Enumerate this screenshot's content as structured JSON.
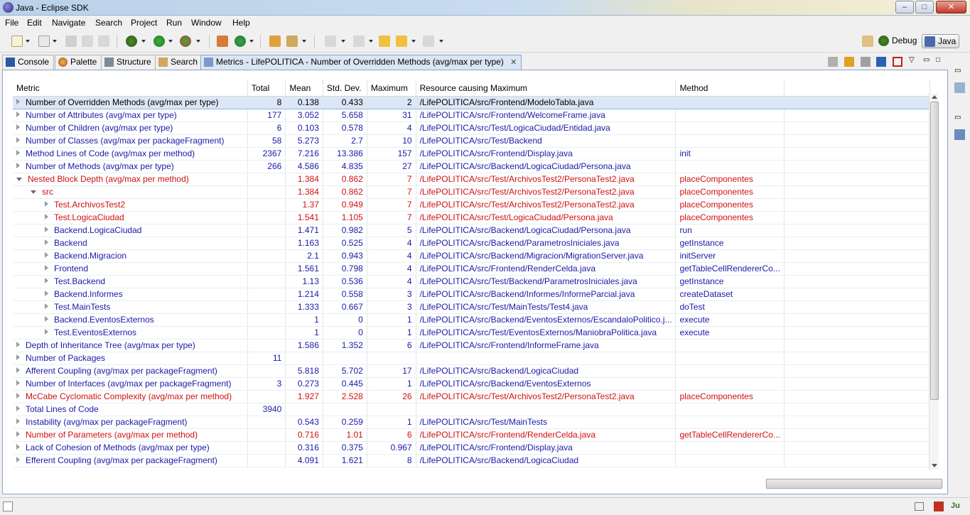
{
  "window": {
    "title": "Java - Eclipse SDK",
    "min": "–",
    "max": "□",
    "close": "✕"
  },
  "menu": [
    "File",
    "Edit",
    "Navigate",
    "Search",
    "Project",
    "Run",
    "Window",
    "Help"
  ],
  "perspectives": {
    "debug": "Debug",
    "java": "Java"
  },
  "tabs": {
    "console": "Console",
    "palette": "Palette",
    "structure": "Structure",
    "search": "Search",
    "metrics": "Metrics - LifePOLITICA - Number of Overridden Methods (avg/max per type)",
    "close": "✕"
  },
  "columns": [
    "Metric",
    "Total",
    "Mean",
    "Std. Dev.",
    "Maximum",
    "Resource causing Maximum",
    "Method"
  ],
  "rows": [
    {
      "metric": "Number of Overridden Methods (avg/max per type)",
      "total": "8",
      "mean": "0.138",
      "std": "0.433",
      "max": "2",
      "resource": "/LifePOLITICA/src/Frontend/ModeloTabla.java",
      "method": ""
    },
    {
      "metric": "Number of Attributes (avg/max per type)",
      "total": "177",
      "mean": "3.052",
      "std": "5.658",
      "max": "31",
      "resource": "/LifePOLITICA/src/Frontend/WelcomeFrame.java",
      "method": ""
    },
    {
      "metric": "Number of Children (avg/max per type)",
      "total": "6",
      "mean": "0.103",
      "std": "0.578",
      "max": "4",
      "resource": "/LifePOLITICA/src/Test/LogicaCiudad/Entidad.java",
      "method": ""
    },
    {
      "metric": "Number of Classes (avg/max per packageFragment)",
      "total": "58",
      "mean": "5.273",
      "std": "2.7",
      "max": "10",
      "resource": "/LifePOLITICA/src/Test/Backend",
      "method": ""
    },
    {
      "metric": "Method Lines of Code (avg/max per method)",
      "total": "2367",
      "mean": "7.216",
      "std": "13.386",
      "max": "157",
      "resource": "/LifePOLITICA/src/Frontend/Display.java",
      "method": "init"
    },
    {
      "metric": "Number of Methods (avg/max per type)",
      "total": "266",
      "mean": "4.586",
      "std": "4.835",
      "max": "27",
      "resource": "/LifePOLITICA/src/Backend/LogicaCiudad/Persona.java",
      "method": ""
    },
    {
      "metric": "Nested Block Depth (avg/max per method)",
      "total": "",
      "mean": "1.384",
      "std": "0.862",
      "max": "7",
      "resource": "/LifePOLITICA/src/Test/ArchivosTest2/PersonaTest2.java",
      "method": "placeComponentes"
    },
    {
      "metric": "src",
      "total": "",
      "mean": "1.384",
      "std": "0.862",
      "max": "7",
      "resource": "/LifePOLITICA/src/Test/ArchivosTest2/PersonaTest2.java",
      "method": "placeComponentes"
    },
    {
      "metric": "Test.ArchivosTest2",
      "total": "",
      "mean": "1.37",
      "std": "0.949",
      "max": "7",
      "resource": "/LifePOLITICA/src/Test/ArchivosTest2/PersonaTest2.java",
      "method": "placeComponentes"
    },
    {
      "metric": "Test.LogicaCiudad",
      "total": "",
      "mean": "1.541",
      "std": "1.105",
      "max": "7",
      "resource": "/LifePOLITICA/src/Test/LogicaCiudad/Persona.java",
      "method": "placeComponentes"
    },
    {
      "metric": "Backend.LogicaCiudad",
      "total": "",
      "mean": "1.471",
      "std": "0.982",
      "max": "5",
      "resource": "/LifePOLITICA/src/Backend/LogicaCiudad/Persona.java",
      "method": "run"
    },
    {
      "metric": "Backend",
      "total": "",
      "mean": "1.163",
      "std": "0.525",
      "max": "4",
      "resource": "/LifePOLITICA/src/Backend/ParametrosIniciales.java",
      "method": "getInstance"
    },
    {
      "metric": "Backend.Migracion",
      "total": "",
      "mean": "2.1",
      "std": "0.943",
      "max": "4",
      "resource": "/LifePOLITICA/src/Backend/Migracion/MigrationServer.java",
      "method": "initServer"
    },
    {
      "metric": "Frontend",
      "total": "",
      "mean": "1.561",
      "std": "0.798",
      "max": "4",
      "resource": "/LifePOLITICA/src/Frontend/RenderCelda.java",
      "method": "getTableCellRendererCo..."
    },
    {
      "metric": "Test.Backend",
      "total": "",
      "mean": "1.13",
      "std": "0.536",
      "max": "4",
      "resource": "/LifePOLITICA/src/Test/Backend/ParametrosIniciales.java",
      "method": "getInstance"
    },
    {
      "metric": "Backend.Informes",
      "total": "",
      "mean": "1.214",
      "std": "0.558",
      "max": "3",
      "resource": "/LifePOLITICA/src/Backend/Informes/InformeParcial.java",
      "method": "createDataset"
    },
    {
      "metric": "Test.MainTests",
      "total": "",
      "mean": "1.333",
      "std": "0.667",
      "max": "3",
      "resource": "/LifePOLITICA/src/Test/MainTests/Test4.java",
      "method": "doTest"
    },
    {
      "metric": "Backend.EventosExternos",
      "total": "",
      "mean": "1",
      "std": "0",
      "max": "1",
      "resource": "/LifePOLITICA/src/Backend/EventosExternos/EscandaloPolitico.j...",
      "method": "execute"
    },
    {
      "metric": "Test.EventosExternos",
      "total": "",
      "mean": "1",
      "std": "0",
      "max": "1",
      "resource": "/LifePOLITICA/src/Test/EventosExternos/ManiobraPolitica.java",
      "method": "execute"
    },
    {
      "metric": "Depth of Inheritance Tree (avg/max per type)",
      "total": "",
      "mean": "1.586",
      "std": "1.352",
      "max": "6",
      "resource": "/LifePOLITICA/src/Frontend/InformeFrame.java",
      "method": ""
    },
    {
      "metric": "Number of Packages",
      "total": "11",
      "mean": "",
      "std": "",
      "max": "",
      "resource": "",
      "method": ""
    },
    {
      "metric": "Afferent Coupling (avg/max per packageFragment)",
      "total": "",
      "mean": "5.818",
      "std": "5.702",
      "max": "17",
      "resource": "/LifePOLITICA/src/Backend/LogicaCiudad",
      "method": ""
    },
    {
      "metric": "Number of Interfaces (avg/max per packageFragment)",
      "total": "3",
      "mean": "0.273",
      "std": "0.445",
      "max": "1",
      "resource": "/LifePOLITICA/src/Backend/EventosExternos",
      "method": ""
    },
    {
      "metric": "McCabe Cyclomatic Complexity (avg/max per method)",
      "total": "",
      "mean": "1.927",
      "std": "2.528",
      "max": "26",
      "resource": "/LifePOLITICA/src/Test/ArchivosTest2/PersonaTest2.java",
      "method": "placeComponentes"
    },
    {
      "metric": "Total Lines of Code",
      "total": "3940",
      "mean": "",
      "std": "",
      "max": "",
      "resource": "",
      "method": ""
    },
    {
      "metric": "Instability (avg/max per packageFragment)",
      "total": "",
      "mean": "0.543",
      "std": "0.259",
      "max": "1",
      "resource": "/LifePOLITICA/src/Test/MainTests",
      "method": ""
    },
    {
      "metric": "Number of Parameters (avg/max per method)",
      "total": "",
      "mean": "0.716",
      "std": "1.01",
      "max": "6",
      "resource": "/LifePOLITICA/src/Frontend/RenderCelda.java",
      "method": "getTableCellRendererCo..."
    },
    {
      "metric": "Lack of Cohesion of Methods (avg/max per type)",
      "total": "",
      "mean": "0.316",
      "std": "0.375",
      "max": "0.967",
      "resource": "/LifePOLITICA/src/Frontend/Display.java",
      "method": ""
    },
    {
      "metric": "Efferent Coupling (avg/max per packageFragment)",
      "total": "",
      "mean": "4.091",
      "std": "1.621",
      "max": "8",
      "resource": "/LifePOLITICA/src/Backend/LogicaCiudad",
      "method": ""
    }
  ],
  "colors": {
    "link": "#1a1aa8",
    "warn": "#d01010",
    "selection": "#dbe7f6",
    "tabActive": "#dbe6f4"
  }
}
